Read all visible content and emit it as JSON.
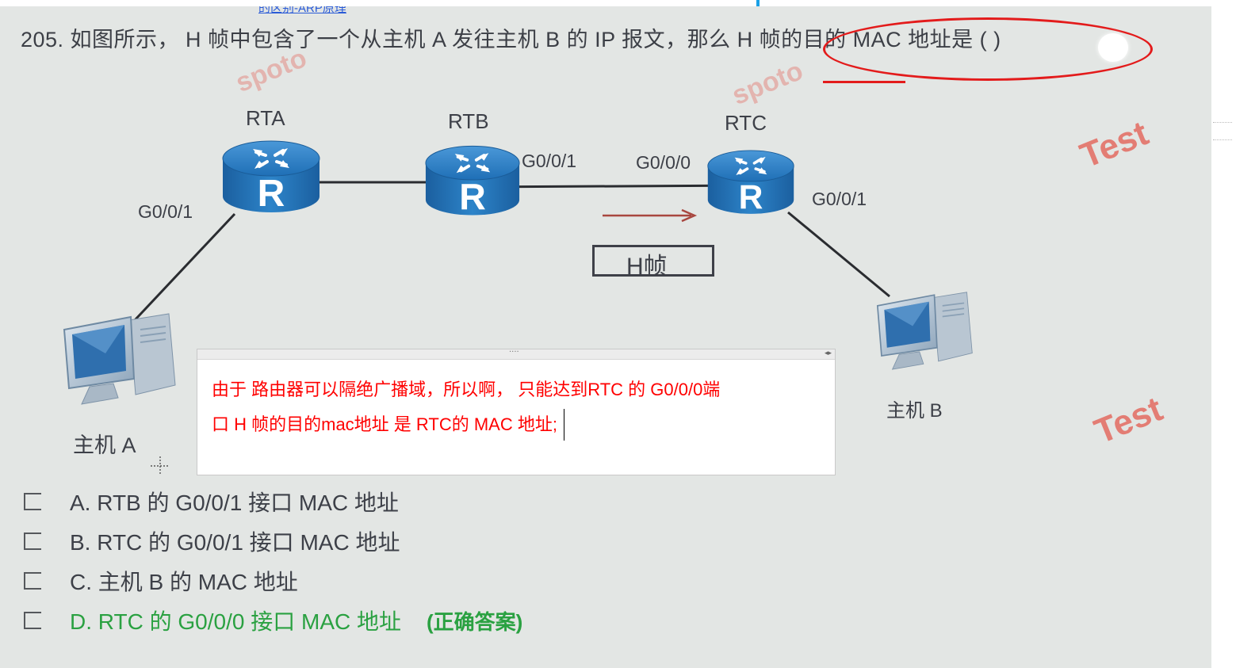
{
  "top_link": "的区别-ARP原理",
  "question": "205. 如图所示， H 帧中包含了一个从主机 A 发往主机 B 的 IP 报文，那么 H 帧的目的 MAC 地址是 (  )",
  "watermarks": [
    "spoto",
    "spoto",
    "Test",
    "Test"
  ],
  "routers": [
    {
      "name": "RTA",
      "icon": "router-icon",
      "letter": "R"
    },
    {
      "name": "RTB",
      "icon": "router-icon",
      "letter": "R"
    },
    {
      "name": "RTC",
      "icon": "router-icon",
      "letter": "R"
    }
  ],
  "ports": {
    "rta_g001": "G0/0/1",
    "rtb_g001": "G0/0/1",
    "rtc_g000": "G0/0/0",
    "rtc_g001": "G0/0/1"
  },
  "frame_label": "H帧",
  "hosts": {
    "a": "主机 A",
    "b": "主机 B"
  },
  "options": [
    {
      "label": "A. RTB 的  G0/0/1 接口  MAC 地址"
    },
    {
      "label": "B. RTC 的  G0/0/1 接口  MAC 地址"
    },
    {
      "label": "C. 主机  B 的  MAC 地址"
    },
    {
      "label": "D. RTC 的  G0/0/0 接口  MAC 地址",
      "note": "(正确答案)"
    }
  ],
  "annotation": {
    "line1": "由于 路由器可以隔绝广播域，所以啊，  只能达到RTC 的 G0/0/0端",
    "line2": "口  H 帧的目的mac地址 是  RTC的 MAC 地址;"
  },
  "colors": {
    "annotation_text": "#ff0000",
    "highlight_ellipse": "#e31b1b",
    "correct_option": "#2aa141",
    "router_blue": "#1e6fb8"
  }
}
